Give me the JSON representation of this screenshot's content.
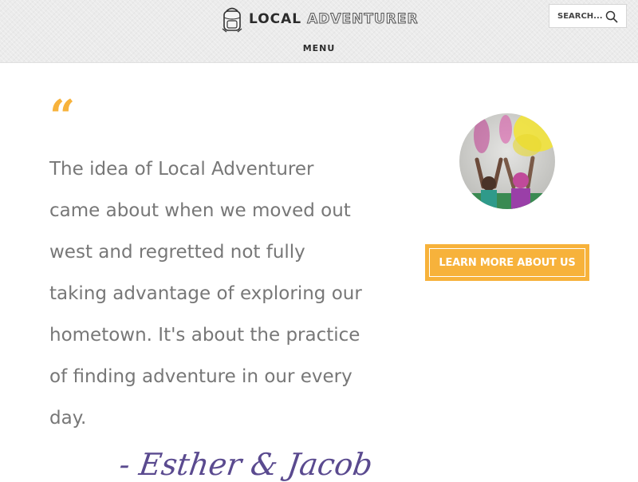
{
  "header": {
    "logo": {
      "word1": "LOCAL",
      "word2": "ADVENTURER",
      "icon": "backpack-icon"
    },
    "menu_label": "MENU",
    "search": {
      "placeholder": "SEARCH...",
      "value": "",
      "icon": "search-icon"
    }
  },
  "quote": {
    "mark": "“",
    "text": "The idea of Local Adventurer came about when we moved out west and regretted not fully taking advantage of exploring our hometown. It's about the practice of finding adventure in our every day.",
    "signature": "- Esther & Jacob"
  },
  "sidebar": {
    "photo": "founders-photo",
    "button_label": "LEARN MORE ABOUT US"
  },
  "colors": {
    "accent": "#f7b23b",
    "text": "#777777",
    "header_bg": "#ebebeb",
    "signature": "#5a4a8f"
  }
}
